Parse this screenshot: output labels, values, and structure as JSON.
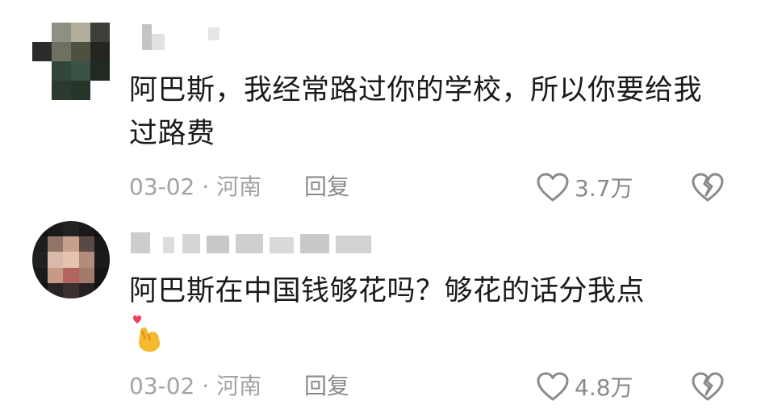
{
  "comments": [
    {
      "text": "阿巴斯，我经常路过你的学校，所以你要给我过路费",
      "date": "03-02",
      "separator": "·",
      "location": "河南",
      "reply_label": "回复",
      "like_count": "3.7万",
      "icons": [
        "heart-outline-icon",
        "broken-heart-icon"
      ]
    },
    {
      "text": "阿巴斯在中国钱够花吗？够花的话分我点",
      "emoji": "🫰",
      "date": "03-02",
      "separator": "·",
      "location": "河南",
      "reply_label": "回复",
      "like_count": "4.8万",
      "icons": [
        "heart-outline-icon",
        "broken-heart-icon"
      ]
    }
  ],
  "colors": {
    "text": "#1a1a1a",
    "meta": "#a3a3a3",
    "icon": "#8a8a8a",
    "emoji_hand": "#f5b92f",
    "emoji_heart": "#ef3e5c"
  }
}
